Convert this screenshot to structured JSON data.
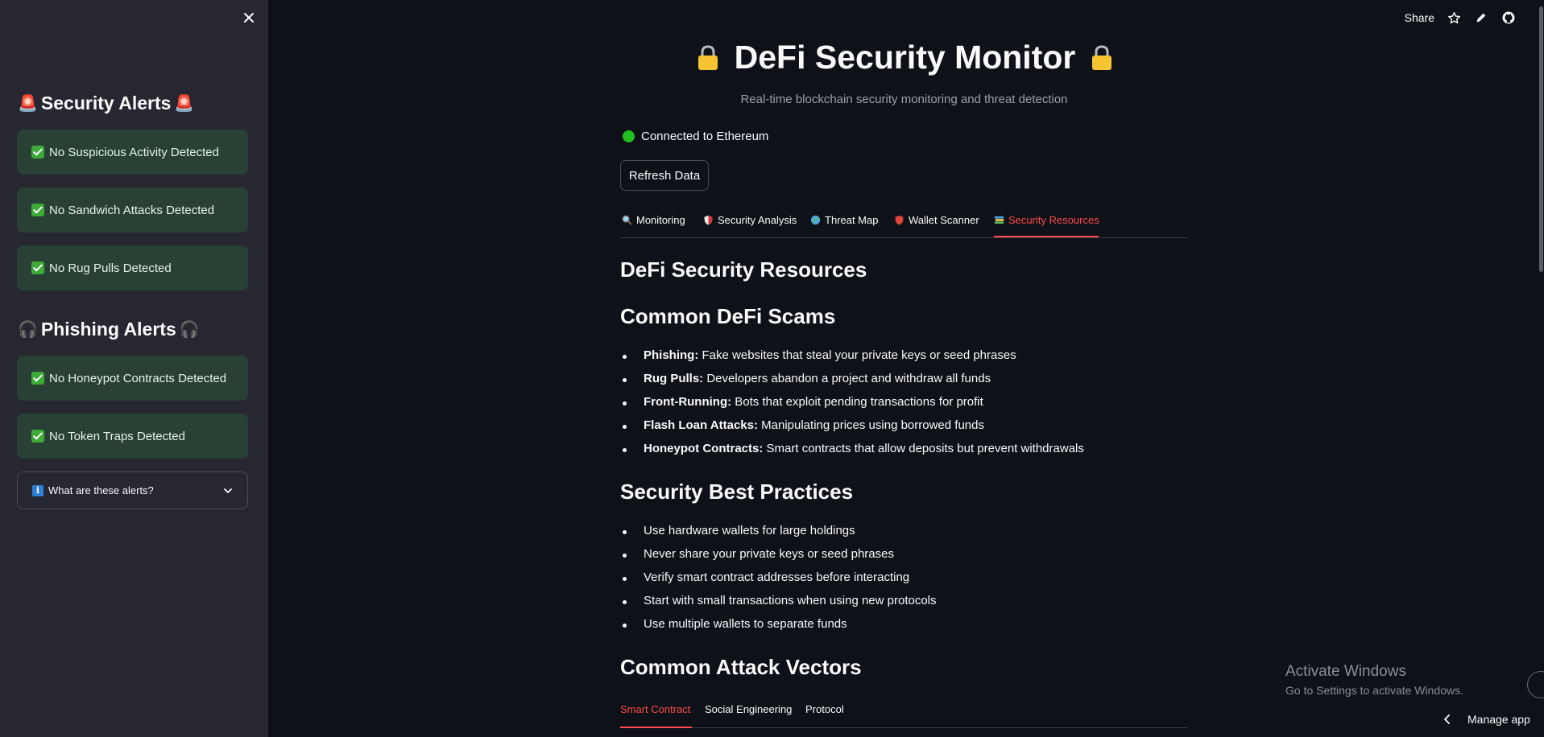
{
  "sidebar": {
    "security_heading": "Security Alerts",
    "security_alerts": [
      "No Suspicious Activity Detected",
      "No Sandwich Attacks Detected",
      "No Rug Pulls Detected"
    ],
    "phishing_heading": "Phishing Alerts",
    "phishing_alerts": [
      "No Honeypot Contracts Detected",
      "No Token Traps Detected"
    ],
    "expander_label": "What are these alerts?"
  },
  "toolbar": {
    "share_label": "Share"
  },
  "main": {
    "title": "DeFi Security Monitor",
    "subtitle": "Real-time blockchain security monitoring and threat detection",
    "status": "Connected to Ethereum",
    "refresh_label": "Refresh Data",
    "tabs": [
      {
        "label": "Monitoring",
        "icon": "magnifier-icon"
      },
      {
        "label": "Security Analysis",
        "icon": "shield-icon"
      },
      {
        "label": "Threat Map",
        "icon": "globe-icon"
      },
      {
        "label": "Wallet Scanner",
        "icon": "red-shield-icon"
      },
      {
        "label": "Security Resources",
        "icon": "books-icon",
        "active": true
      }
    ],
    "resources_heading": "DeFi Security Resources",
    "scams_heading": "Common DeFi Scams",
    "scams": [
      {
        "term": "Phishing:",
        "desc": "Fake websites that steal your private keys or seed phrases"
      },
      {
        "term": "Rug Pulls:",
        "desc": "Developers abandon a project and withdraw all funds"
      },
      {
        "term": "Front-Running:",
        "desc": "Bots that exploit pending transactions for profit"
      },
      {
        "term": "Flash Loan Attacks:",
        "desc": "Manipulating prices using borrowed funds"
      },
      {
        "term": "Honeypot Contracts:",
        "desc": "Smart contracts that allow deposits but prevent withdrawals"
      }
    ],
    "practices_heading": "Security Best Practices",
    "practices": [
      "Use hardware wallets for large holdings",
      "Never share your private keys or seed phrases",
      "Verify smart contract addresses before interacting",
      "Start with small transactions when using new protocols",
      "Use multiple wallets to separate funds"
    ],
    "vectors_heading": "Common Attack Vectors",
    "vector_tabs": [
      "Smart Contract",
      "Social Engineering",
      "Protocol"
    ]
  },
  "watermark": {
    "line1": "Activate Windows",
    "line2": "Go to Settings to activate Windows."
  },
  "manage_app": "Manage app",
  "colors": {
    "accent": "#ff4b4b",
    "success_bg": "#294034",
    "status_green": "#21c021"
  }
}
